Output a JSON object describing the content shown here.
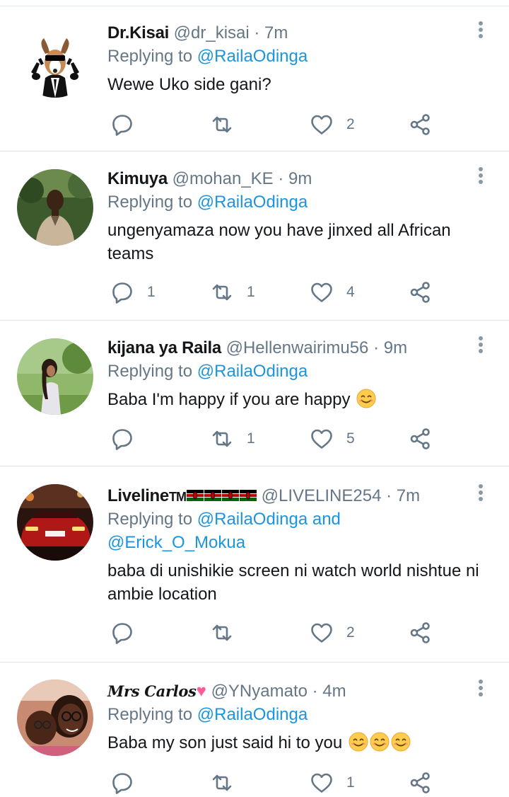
{
  "colors": {
    "accent": "#1b95e0",
    "secondary": "#657786",
    "divider": "#dfe3e6",
    "icon": "#657786"
  },
  "tweets": [
    {
      "name": "Dr.Kisai",
      "handle": "@dr_kisai",
      "time": "· 7m",
      "replying_prefix": "Replying to",
      "replying_to": "@RailaOdinga",
      "text": "Wewe Uko side gani?",
      "avatar_icon": "dog-in-suit-avatar",
      "reply_count": "",
      "retweet_count": "",
      "like_count": "2"
    },
    {
      "name": "Kimuya",
      "handle": "@mohan_KE",
      "time": "· 9m",
      "replying_prefix": "Replying to",
      "replying_to": "@RailaOdinga",
      "text": "ungenyamaza now you have jinxed all African teams",
      "avatar_icon": "man-outdoors-avatar",
      "reply_count": "1",
      "retweet_count": "1",
      "like_count": "4"
    },
    {
      "name": "kijana ya Raila",
      "handle": "@Hellenwairimu56",
      "time": "· 9m",
      "replying_prefix": "Replying to",
      "replying_to": "@RailaOdinga",
      "text": "Baba I'm happy if you are happy",
      "avatar_icon": "child-garden-avatar",
      "reply_count": "",
      "retweet_count": "1",
      "like_count": "5"
    },
    {
      "name": "Liveline",
      "name_suffix": "TM",
      "handle": "@LIVELINE254",
      "time": "· 7m",
      "replying_prefix": "Replying to",
      "replying_to": "@RailaOdinga and",
      "replying_to_2": "@Erick_O_Mokua",
      "text": "baba di unishikie screen ni watch world nishtue ni ambie location",
      "avatar_icon": "red-car-avatar",
      "reply_count": "",
      "retweet_count": "",
      "like_count": "2"
    },
    {
      "name": "Mrs Carlos",
      "handle": "@YNyamato",
      "time": "· 4m",
      "replying_prefix": "Replying to",
      "replying_to": "@RailaOdinga",
      "text": "Baba my son just said hi to you",
      "avatar_icon": "mother-child-selfie-avatar",
      "reply_count": "",
      "retweet_count": "",
      "like_count": "1"
    }
  ]
}
